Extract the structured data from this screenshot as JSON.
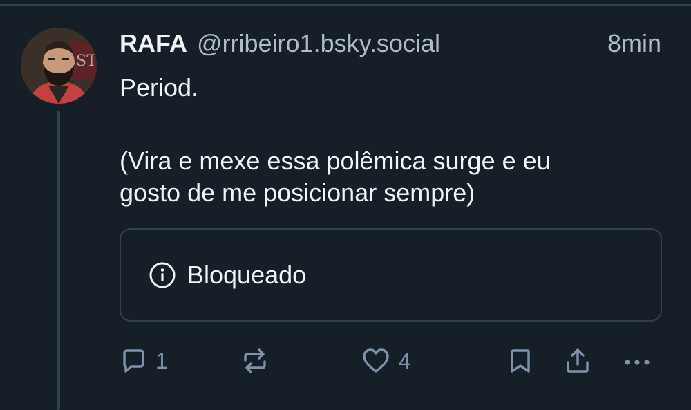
{
  "post": {
    "author": {
      "display_name": "RAFA",
      "handle": "@rribeiro1.bsky.social"
    },
    "timestamp": "8min",
    "text": {
      "line1": "Period.",
      "line2": "(Vira e mexe essa polêmica surge e eu",
      "line3": "gosto de me posicionar sempre)"
    },
    "embed": {
      "icon": "info-icon",
      "label": "Bloqueado"
    },
    "actions": {
      "reply_count": "1",
      "repost_count": "",
      "like_count": "4"
    }
  },
  "colors": {
    "background": "#161e27",
    "divider": "#2e4052",
    "primary_text": "#f1f3f5",
    "secondary_text": "#aebbc9",
    "icon": "#7e93ab"
  }
}
